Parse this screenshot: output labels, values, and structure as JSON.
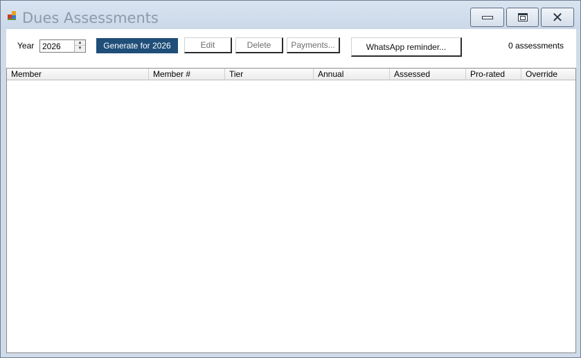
{
  "window": {
    "title": "Dues Assessments"
  },
  "toolbar": {
    "year_label": "Year",
    "year_value": "2026",
    "generate_label": "Generate for 2026",
    "edit_label": "Edit",
    "delete_label": "Delete",
    "payments_label": "Payments...",
    "whatsapp_label": "WhatsApp reminder...",
    "count_text": "0 assessments"
  },
  "grid": {
    "columns": [
      "Member",
      "Member #",
      "Tier",
      "Annual",
      "Assessed",
      "Pro-rated",
      "Override"
    ],
    "rows": []
  },
  "colors": {
    "accent": "#1f4e79",
    "titlebar": "#cfdbe9"
  }
}
